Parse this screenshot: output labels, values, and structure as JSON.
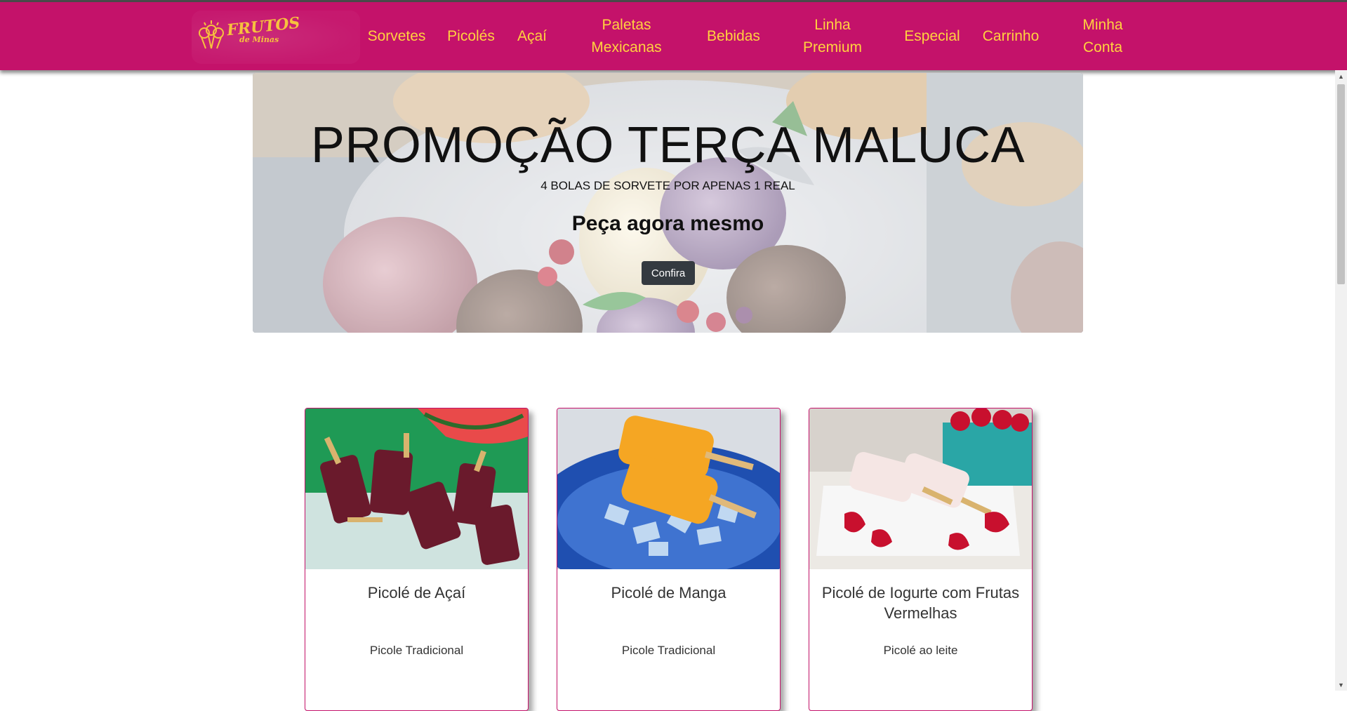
{
  "brand": {
    "name_line1": "FRUTOS",
    "name_line2": "de Minas",
    "accent": "#c4126a",
    "nav_text_color": "#ffd23f"
  },
  "nav": {
    "items": [
      {
        "label": "Sorvetes"
      },
      {
        "label": "Picolés"
      },
      {
        "label": "Açaí"
      },
      {
        "label": "Paletas Mexicanas"
      },
      {
        "label": "Bebidas"
      },
      {
        "label": "Linha Premium"
      },
      {
        "label": "Especial"
      },
      {
        "label": "Carrinho"
      },
      {
        "label": "Minha Conta"
      }
    ]
  },
  "hero": {
    "title": "PROMOÇÃO TERÇA MALUCA",
    "subtitle": "4 BOLAS DE SORVETE POR APENAS 1 REAL",
    "cta_text": "Peça agora mesmo",
    "button_label": "Confira"
  },
  "products": [
    {
      "name": "Picolé de Açaí",
      "category": "Picole Tradicional",
      "image": "acai-popsicles-photo"
    },
    {
      "name": "Picolé de Manga",
      "category": "Picole Tradicional",
      "image": "mango-popsicles-photo"
    },
    {
      "name": "Picolé de Iogurte com Frutas Vermelhas",
      "category": "Picolé ao leite",
      "image": "yogurt-berry-popsicles-photo"
    }
  ]
}
